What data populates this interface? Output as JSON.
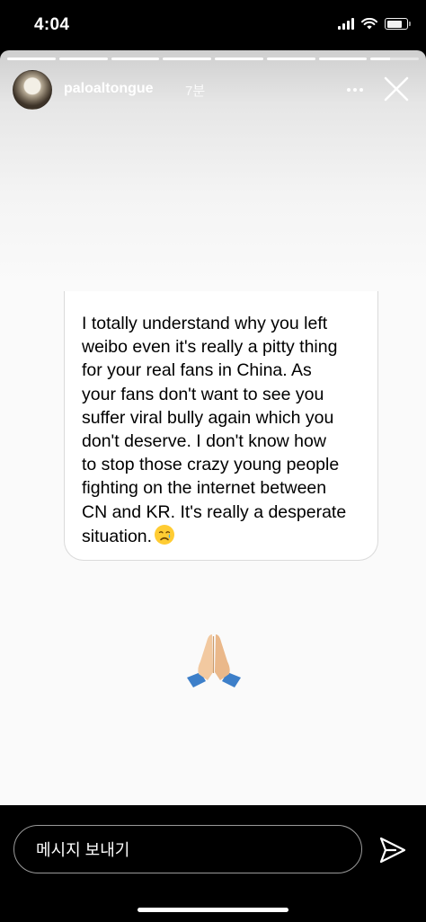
{
  "status_bar": {
    "time": "4:04",
    "battery_level": 0.8
  },
  "story": {
    "progress": [
      1,
      1,
      1,
      1,
      1,
      1,
      1,
      0.4
    ],
    "username": "paloaltongue",
    "time_ago": "7분",
    "message": "I totally understand why you left\nweibo even it's really a pitty thing\nfor your real fans in China. As\nyour fans don't want to see you\nsuffer viral bully again which you\ndon't deserve. I don't know how\nto stop those crazy young people\nfighting on the internet between\nCN and KR. It's really a desperate\nsituation.",
    "message_emoji": "crying-face-icon",
    "sticker": "folded-hands-icon"
  },
  "reply": {
    "placeholder": "메시지 보내기"
  },
  "icons": {
    "more": "more-options-icon",
    "close": "close-icon",
    "send": "send-icon"
  }
}
